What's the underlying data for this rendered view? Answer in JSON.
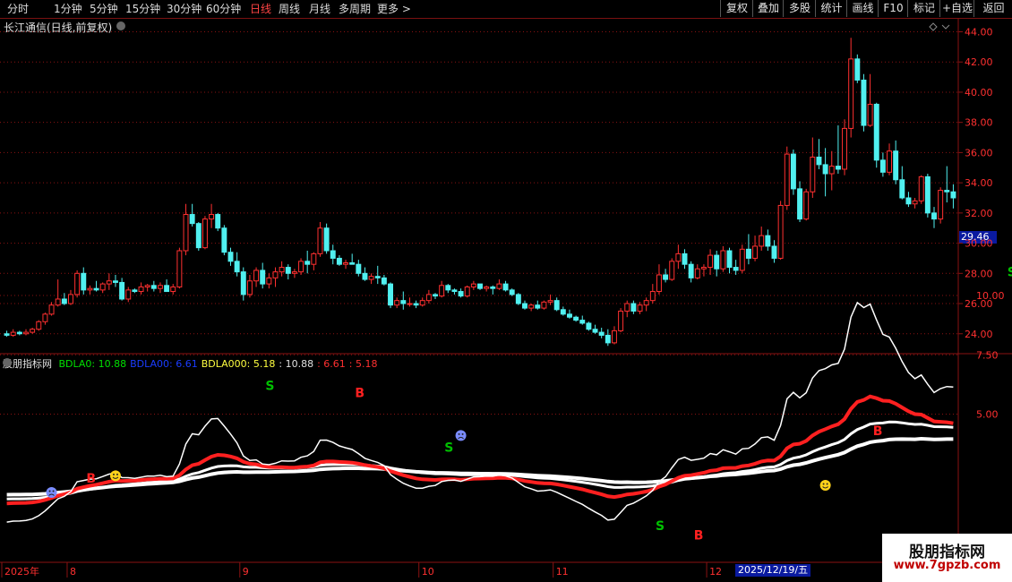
{
  "toolbar": {
    "periods": [
      "分时",
      "1分钟",
      "5分钟",
      "15分钟",
      "30分钟",
      "60分钟",
      "日线",
      "周线",
      "月线",
      "多周期",
      "更多 >"
    ],
    "active_period": "日线",
    "right_buttons": [
      "复权",
      "叠加",
      "多股",
      "统计",
      "画线",
      "F10",
      "标记",
      "+自选",
      "返回"
    ]
  },
  "stock": {
    "title": "长江通信(日线,前复权)",
    "last_price_tag": "29.46"
  },
  "indicator": {
    "name": "股朋指标网",
    "labels": [
      {
        "text": "BDLA0: 10.88",
        "color": "#00e000"
      },
      {
        "text": "BDLA00: 6.61",
        "color": "#1a3cff"
      },
      {
        "text": "BDLA000: 5.18",
        "color": "#ffff40"
      },
      {
        "text": ": 10.88",
        "color": "#e0e0e0"
      },
      {
        "text": ": 6.61",
        "color": "#ff3030"
      },
      {
        "text": ": 5.18",
        "color": "#ff3030"
      }
    ],
    "signals": [
      {
        "text": "S",
        "color": "#00c000",
        "bar": 41,
        "val": 6.2
      },
      {
        "text": "B",
        "color": "#ff2020",
        "bar": 55,
        "val": 5.9
      },
      {
        "text": "S",
        "color": "#00c000",
        "bar": 69,
        "val": 3.6
      },
      {
        "text": "S",
        "color": "#00c000",
        "bar": 102,
        "val": 0.3
      },
      {
        "text": "B",
        "color": "#ff2020",
        "bar": 13,
        "val": 2.3
      },
      {
        "text": "B",
        "color": "#ff2020",
        "bar": 108,
        "val": -0.1
      },
      {
        "text": "B",
        "color": "#ff2020",
        "bar": 136,
        "val": 4.3
      },
      {
        "text": "S",
        "color": "#00c000",
        "bar": 157,
        "val": 11.0
      }
    ],
    "faces": [
      {
        "type": "sad",
        "bar": 7,
        "val": 1.7
      },
      {
        "type": "happy",
        "bar": 17,
        "val": 2.4
      },
      {
        "type": "sad",
        "bar": 71,
        "val": 4.1
      },
      {
        "type": "happy",
        "bar": 128,
        "val": 2.0
      }
    ]
  },
  "price_axis": [
    "44.00",
    "42.00",
    "40.00",
    "38.00",
    "36.00",
    "34.00",
    "32.00",
    "30.00",
    "28.00",
    "26.00",
    "24.00"
  ],
  "indicator_axis": [
    "10.00",
    "7.50",
    "5.00"
  ],
  "date_axis": [
    {
      "text": "2025年",
      "bar": 0
    },
    {
      "text": "8",
      "bar": 10
    },
    {
      "text": "9",
      "bar": 37
    },
    {
      "text": "10",
      "bar": 65
    },
    {
      "text": "11",
      "bar": 86
    },
    {
      "text": "12",
      "bar": 110
    },
    {
      "text": "2025/12/19/五",
      "bar": 128
    }
  ],
  "watermark": {
    "title": "股朋指标网",
    "url": "www.7gpzb.com"
  },
  "colors": {
    "up": "#ff3030",
    "down": "#50f0f0",
    "grid": "#8a1212",
    "bg": "#000000"
  },
  "chart_data": {
    "type": "candlestick",
    "ylim": [
      22.8,
      44.8
    ],
    "candles": [
      [
        24.0,
        24.2,
        23.8,
        23.9
      ],
      [
        23.9,
        24.3,
        23.8,
        24.1
      ],
      [
        24.1,
        24.2,
        23.9,
        24.0
      ],
      [
        24.0,
        24.3,
        23.9,
        24.1
      ],
      [
        24.1,
        24.4,
        24.0,
        24.3
      ],
      [
        24.3,
        24.9,
        24.2,
        24.8
      ],
      [
        24.8,
        25.4,
        24.6,
        25.3
      ],
      [
        25.3,
        26.1,
        25.2,
        25.9
      ],
      [
        25.9,
        27.6,
        25.8,
        26.3
      ],
      [
        26.3,
        26.7,
        25.9,
        26.0
      ],
      [
        26.0,
        26.9,
        25.9,
        26.6
      ],
      [
        26.6,
        28.2,
        26.4,
        28.0
      ],
      [
        28.0,
        28.4,
        26.6,
        26.9
      ],
      [
        26.9,
        27.2,
        26.6,
        27.0
      ],
      [
        27.0,
        27.5,
        26.8,
        26.9
      ],
      [
        26.9,
        27.4,
        26.7,
        27.3
      ],
      [
        27.3,
        28.0,
        26.9,
        27.5
      ],
      [
        27.5,
        27.9,
        27.1,
        27.4
      ],
      [
        27.4,
        27.7,
        26.2,
        26.3
      ],
      [
        26.3,
        27.1,
        26.1,
        26.9
      ],
      [
        26.9,
        27.0,
        26.7,
        26.8
      ],
      [
        26.8,
        27.4,
        26.6,
        27.1
      ],
      [
        27.1,
        27.3,
        26.8,
        27.2
      ],
      [
        27.2,
        27.5,
        26.8,
        27.0
      ],
      [
        27.0,
        27.4,
        26.7,
        27.2
      ],
      [
        27.2,
        27.6,
        26.8,
        26.8
      ],
      [
        26.8,
        27.3,
        26.6,
        27.1
      ],
      [
        27.1,
        29.7,
        27.0,
        29.5
      ],
      [
        29.5,
        32.6,
        29.2,
        31.9
      ],
      [
        31.9,
        32.6,
        31.1,
        31.3
      ],
      [
        31.3,
        31.4,
        29.5,
        29.7
      ],
      [
        29.7,
        31.8,
        29.6,
        31.6
      ],
      [
        31.6,
        32.6,
        31.0,
        31.9
      ],
      [
        31.9,
        32.0,
        30.8,
        31.0
      ],
      [
        31.0,
        31.2,
        29.2,
        29.4
      ],
      [
        29.4,
        29.7,
        28.5,
        28.8
      ],
      [
        28.8,
        29.4,
        27.8,
        28.1
      ],
      [
        28.1,
        28.4,
        26.2,
        26.6
      ],
      [
        26.6,
        27.9,
        26.4,
        27.5
      ],
      [
        27.5,
        28.4,
        27.1,
        28.2
      ],
      [
        28.2,
        28.7,
        27.0,
        27.3
      ],
      [
        27.3,
        28.0,
        27.0,
        27.7
      ],
      [
        27.7,
        28.4,
        27.1,
        28.1
      ],
      [
        28.1,
        28.8,
        27.8,
        28.4
      ],
      [
        28.4,
        28.6,
        27.6,
        28.0
      ],
      [
        28.0,
        28.3,
        27.7,
        28.1
      ],
      [
        28.1,
        29.0,
        27.9,
        28.8
      ],
      [
        28.8,
        29.5,
        28.0,
        28.6
      ],
      [
        28.6,
        29.4,
        28.2,
        29.3
      ],
      [
        29.3,
        31.4,
        29.1,
        31.0
      ],
      [
        31.0,
        31.3,
        29.3,
        29.5
      ],
      [
        29.5,
        29.9,
        28.6,
        29.0
      ],
      [
        29.0,
        29.2,
        28.5,
        28.6
      ],
      [
        28.6,
        28.9,
        28.3,
        28.7
      ],
      [
        28.7,
        29.3,
        28.6,
        28.6
      ],
      [
        28.6,
        28.9,
        27.8,
        28.0
      ],
      [
        28.0,
        28.4,
        27.5,
        27.6
      ],
      [
        27.6,
        28.0,
        27.3,
        27.8
      ],
      [
        27.8,
        28.5,
        27.3,
        27.7
      ],
      [
        27.7,
        27.9,
        27.2,
        27.3
      ],
      [
        27.3,
        27.4,
        25.7,
        25.9
      ],
      [
        25.9,
        26.4,
        25.7,
        26.2
      ],
      [
        26.2,
        26.8,
        25.6,
        26.0
      ],
      [
        26.0,
        26.4,
        25.8,
        26.0
      ],
      [
        26.0,
        26.2,
        25.7,
        25.9
      ],
      [
        25.9,
        26.4,
        25.8,
        26.2
      ],
      [
        26.2,
        26.9,
        26.0,
        26.6
      ],
      [
        26.6,
        26.7,
        26.3,
        26.5
      ],
      [
        26.5,
        27.5,
        26.4,
        27.2
      ],
      [
        27.2,
        27.3,
        26.7,
        26.9
      ],
      [
        26.9,
        27.0,
        26.6,
        26.8
      ],
      [
        26.8,
        27.0,
        26.4,
        26.5
      ],
      [
        26.5,
        27.2,
        26.4,
        27.1
      ],
      [
        27.1,
        27.5,
        26.9,
        27.3
      ],
      [
        27.3,
        27.3,
        26.9,
        27.0
      ],
      [
        27.0,
        27.2,
        26.8,
        27.1
      ],
      [
        27.1,
        27.2,
        26.6,
        27.0
      ],
      [
        27.0,
        27.6,
        26.9,
        27.3
      ],
      [
        27.3,
        27.5,
        26.8,
        26.9
      ],
      [
        26.9,
        27.0,
        26.5,
        26.6
      ],
      [
        26.6,
        26.7,
        25.9,
        26.0
      ],
      [
        26.0,
        26.2,
        25.6,
        25.7
      ],
      [
        25.7,
        26.0,
        25.5,
        25.9
      ],
      [
        25.9,
        26.2,
        25.6,
        25.7
      ],
      [
        25.7,
        26.2,
        25.6,
        26.1
      ],
      [
        26.1,
        26.6,
        25.9,
        26.2
      ],
      [
        26.2,
        26.4,
        25.5,
        25.6
      ],
      [
        25.6,
        25.8,
        25.2,
        25.3
      ],
      [
        25.3,
        25.6,
        25.0,
        25.1
      ],
      [
        25.1,
        25.2,
        24.8,
        24.9
      ],
      [
        24.9,
        25.2,
        24.6,
        24.7
      ],
      [
        24.7,
        24.8,
        24.2,
        24.3
      ],
      [
        24.3,
        24.6,
        24.0,
        24.1
      ],
      [
        24.1,
        24.4,
        23.7,
        23.9
      ],
      [
        23.9,
        24.3,
        23.2,
        23.4
      ],
      [
        23.4,
        24.5,
        23.3,
        24.2
      ],
      [
        24.2,
        25.7,
        24.1,
        25.5
      ],
      [
        25.5,
        26.2,
        25.1,
        26.0
      ],
      [
        26.0,
        26.2,
        25.3,
        25.5
      ],
      [
        25.5,
        26.1,
        25.3,
        25.9
      ],
      [
        25.9,
        26.4,
        25.5,
        26.2
      ],
      [
        26.2,
        27.3,
        26.0,
        26.8
      ],
      [
        26.8,
        28.6,
        26.6,
        27.9
      ],
      [
        27.9,
        28.3,
        27.4,
        27.6
      ],
      [
        27.6,
        29.0,
        27.5,
        28.8
      ],
      [
        28.8,
        29.9,
        28.3,
        29.3
      ],
      [
        29.3,
        29.6,
        28.3,
        28.6
      ],
      [
        28.6,
        28.8,
        27.4,
        27.7
      ],
      [
        27.7,
        28.6,
        27.6,
        28.3
      ],
      [
        28.3,
        28.6,
        27.8,
        28.4
      ],
      [
        28.4,
        29.6,
        27.9,
        29.2
      ],
      [
        29.2,
        29.5,
        27.8,
        28.3
      ],
      [
        28.3,
        29.8,
        28.1,
        29.5
      ],
      [
        29.5,
        29.7,
        28.0,
        28.4
      ],
      [
        28.4,
        28.9,
        27.9,
        28.2
      ],
      [
        28.2,
        29.9,
        28.0,
        29.6
      ],
      [
        29.6,
        30.6,
        28.6,
        29.0
      ],
      [
        29.0,
        30.5,
        28.8,
        29.8
      ],
      [
        29.8,
        31.1,
        29.5,
        30.5
      ],
      [
        30.5,
        30.9,
        29.5,
        29.8
      ],
      [
        29.8,
        30.2,
        28.7,
        29.0
      ],
      [
        29.0,
        32.8,
        28.9,
        32.5
      ],
      [
        32.5,
        36.4,
        32.2,
        35.9
      ],
      [
        35.9,
        36.2,
        33.2,
        33.6
      ],
      [
        33.6,
        34.1,
        31.4,
        31.6
      ],
      [
        31.6,
        33.6,
        31.5,
        33.4
      ],
      [
        33.4,
        37.0,
        33.0,
        35.7
      ],
      [
        35.7,
        36.9,
        34.9,
        35.2
      ],
      [
        35.2,
        36.3,
        33.1,
        34.6
      ],
      [
        34.6,
        36.1,
        33.5,
        35.1
      ],
      [
        35.1,
        37.8,
        34.6,
        34.9
      ],
      [
        34.9,
        38.2,
        34.5,
        37.6
      ],
      [
        37.6,
        43.6,
        37.0,
        42.2
      ],
      [
        42.2,
        42.5,
        40.6,
        40.8
      ],
      [
        40.8,
        41.2,
        37.4,
        37.8
      ],
      [
        37.8,
        41.2,
        37.7,
        39.2
      ],
      [
        39.2,
        39.3,
        35.0,
        35.5
      ],
      [
        35.5,
        36.0,
        34.4,
        34.7
      ],
      [
        34.7,
        36.6,
        34.5,
        36.1
      ],
      [
        36.1,
        36.8,
        33.9,
        34.2
      ],
      [
        34.2,
        35.1,
        32.9,
        33.0
      ],
      [
        33.0,
        33.4,
        32.4,
        32.6
      ],
      [
        32.6,
        33.0,
        32.3,
        32.8
      ],
      [
        32.8,
        34.5,
        32.6,
        34.4
      ],
      [
        34.4,
        34.6,
        31.7,
        32.0
      ],
      [
        32.0,
        32.4,
        31.0,
        31.6
      ],
      [
        31.6,
        33.7,
        31.3,
        33.5
      ],
      [
        33.5,
        35.1,
        32.7,
        33.4
      ],
      [
        33.4,
        33.9,
        32.3,
        33.0
      ]
    ]
  }
}
